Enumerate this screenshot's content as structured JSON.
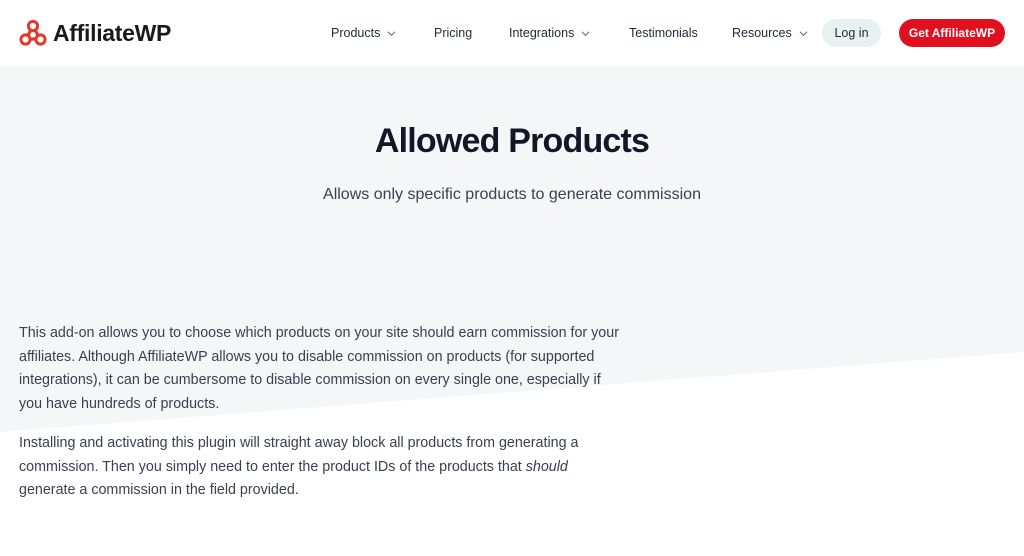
{
  "brand": {
    "name": "AffiliateWP",
    "accent": "#e0101f",
    "logo_icon": "affiliate-network-icon"
  },
  "nav": {
    "items": [
      {
        "label": "Products",
        "dropdown": true
      },
      {
        "label": "Pricing",
        "dropdown": false
      },
      {
        "label": "Integrations",
        "dropdown": true
      },
      {
        "label": "Testimonials",
        "dropdown": false
      },
      {
        "label": "Resources",
        "dropdown": true
      }
    ],
    "login_label": "Log in",
    "cta_label": "Get AffiliateWP"
  },
  "hero": {
    "title": "Allowed Products",
    "subtitle": "Allows only specific products to generate commission"
  },
  "content": {
    "p1": "This add-on allows you to choose which products on your site should earn commission for your affiliates. Although AffiliateWP allows you to disable commission on products (for supported integrations), it can be cumbersome to disable commission on every single one, especially if you have hundreds of products.",
    "p2_before": "Installing and activating this plugin will straight away block all products from generating a commission. Then you simply need to enter the product IDs of the products that ",
    "p2_emphasis": "should",
    "p2_after": " generate a commission in the field provided."
  }
}
